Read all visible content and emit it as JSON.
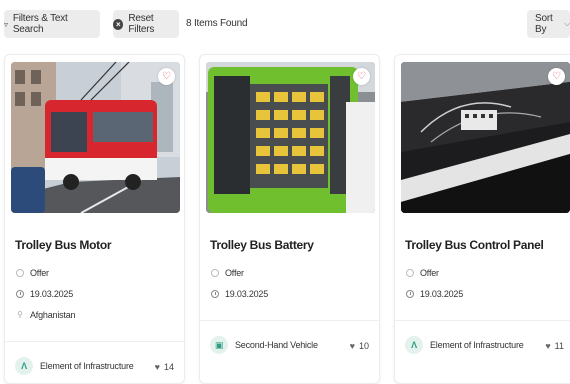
{
  "toolbar": {
    "filters_label": "Filters & Text Search",
    "reset_label": "Reset Filters",
    "items_found": "8 Items Found",
    "sort_label": "Sort By"
  },
  "icons": {
    "filters": "funnel-icon",
    "reset": "close-circle-icon",
    "sort": "chevron-down-icon",
    "favorite": "heart-outline-icon",
    "offer": "radio-circle-icon",
    "date": "clock-icon",
    "location": "map-pin-icon",
    "likes": "heart-icon"
  },
  "colors": {
    "accent": "#2e9c84",
    "favorite": "#e05a6a",
    "button_bg": "#ececec"
  },
  "cards": [
    {
      "title": "Trolley Bus Motor",
      "type": "Offer",
      "date": "19.03.2025",
      "location": "Afghanistan",
      "category": "Element of Infrastructure",
      "category_icon": "A",
      "likes": "14"
    },
    {
      "title": "Trolley Bus Battery",
      "type": "Offer",
      "date": "19.03.2025",
      "category": "Second-Hand Vehicle",
      "category_icon": "bus",
      "likes": "10"
    },
    {
      "title": "Trolley Bus Control Panel",
      "type": "Offer",
      "date": "19.03.2025",
      "category": "Element of Infrastructure",
      "category_icon": "A",
      "likes": "11"
    }
  ]
}
